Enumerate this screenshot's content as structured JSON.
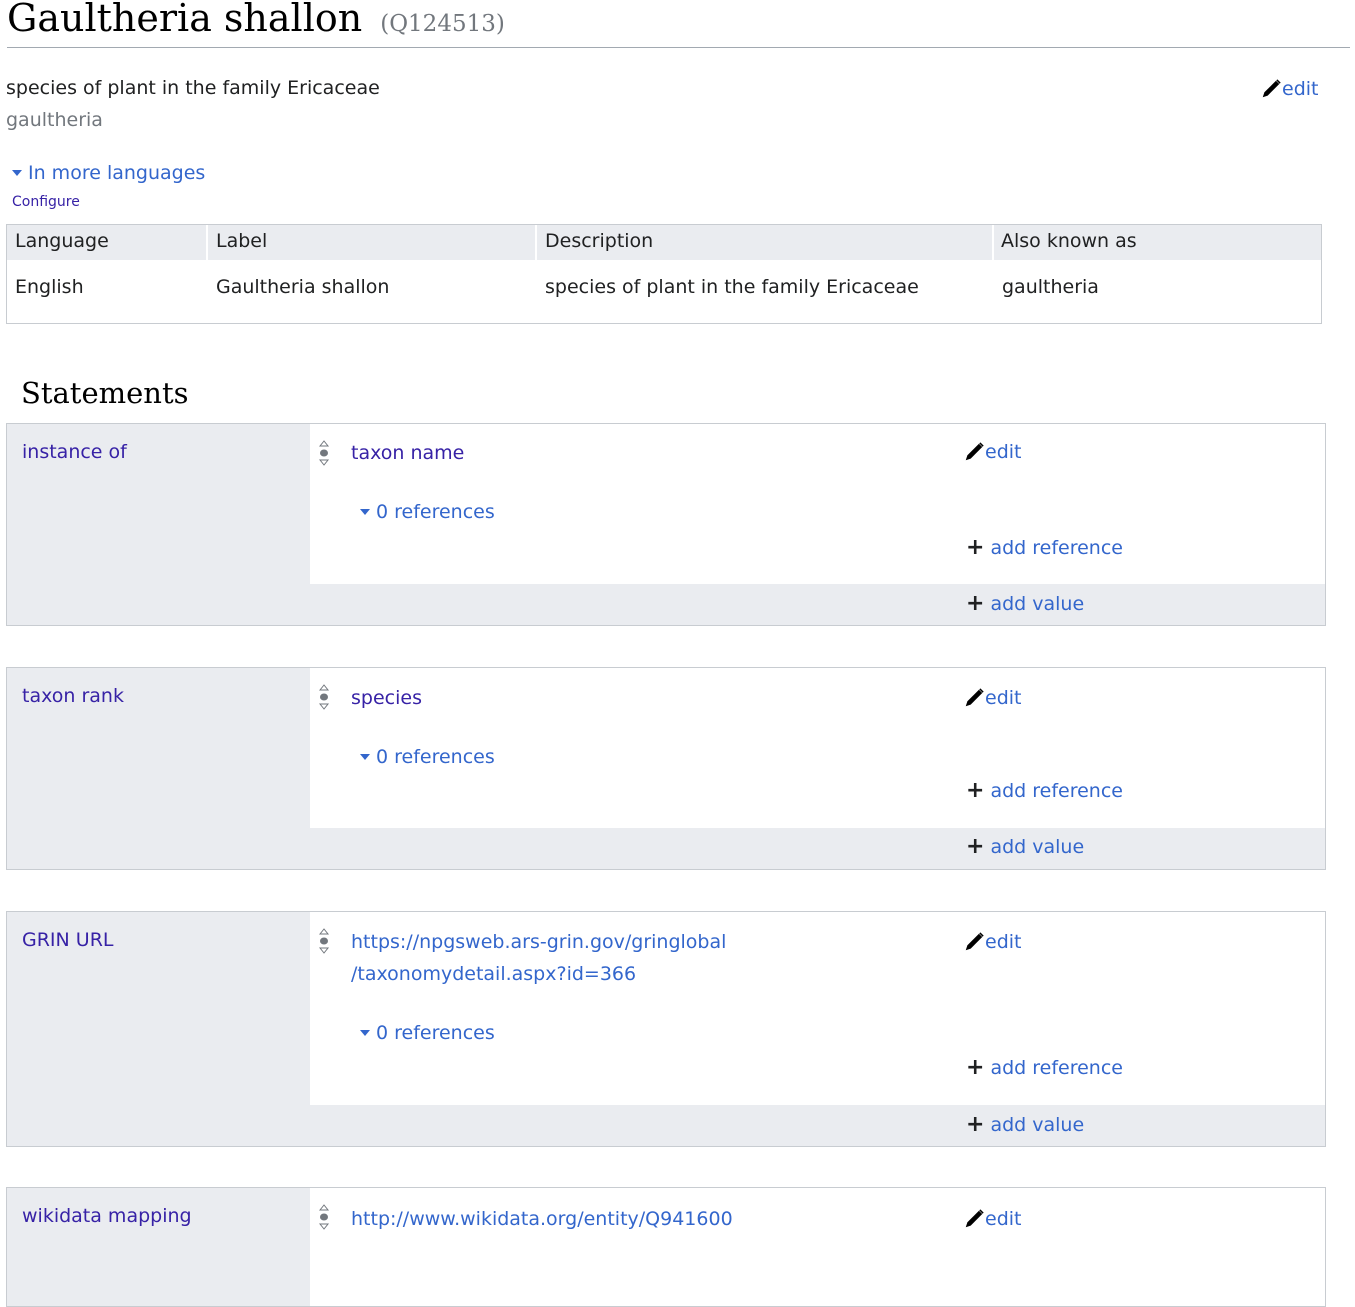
{
  "header": {
    "title": "Gaultheria shallon",
    "id": "(Q124513)"
  },
  "term_box": {
    "description": "species of plant in the family Ericaceae",
    "alias": "gaultheria",
    "edit_label": "edit",
    "more_languages_label": "In more languages",
    "configure_label": "Configure"
  },
  "languages_table": {
    "headers": [
      "Language",
      "Label",
      "Description",
      "Also known as"
    ],
    "rows": [
      [
        "English",
        "Gaultheria shallon",
        "species of plant in the family Ericaceae",
        "gaultheria"
      ]
    ]
  },
  "statements": {
    "heading": "Statements",
    "groups": [
      {
        "property": "instance of",
        "value_lines": [
          "taxon name"
        ],
        "value_type": "item",
        "references_label": "0 references",
        "edit_label": "edit",
        "add_reference_label": "add reference",
        "add_value_label": "add value"
      },
      {
        "property": "taxon rank",
        "value_lines": [
          "species"
        ],
        "value_type": "item",
        "references_label": "0 references",
        "edit_label": "edit",
        "add_reference_label": "add reference",
        "add_value_label": "add value"
      },
      {
        "property": "GRIN URL",
        "value_lines": [
          "https://npgsweb.ars-grin.gov/gringlobal",
          "/taxonomydetail.aspx?id=366"
        ],
        "value_type": "url",
        "references_label": "0 references",
        "edit_label": "edit",
        "add_reference_label": "add reference",
        "add_value_label": "add value"
      },
      {
        "property": "wikidata mapping",
        "value_lines": [
          "http://www.wikidata.org/entity/Q941600"
        ],
        "value_type": "url",
        "edit_label": "edit"
      }
    ]
  },
  "colors": {
    "link": "#3366cc",
    "item_link": "#3722a6",
    "panel_bg": "#eaecf0",
    "border": "#c8ccd1",
    "muted": "#72777d"
  }
}
